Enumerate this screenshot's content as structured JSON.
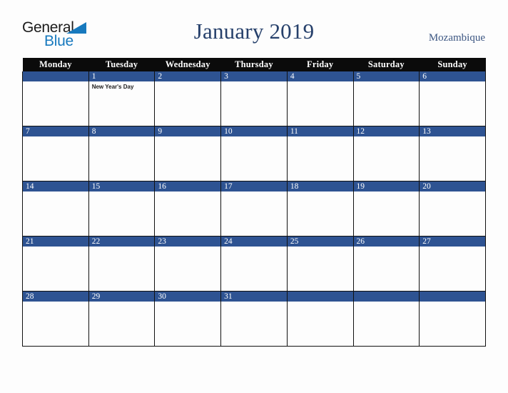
{
  "brand": {
    "line1": "General",
    "line2": "Blue",
    "triangle_color": "#1779be",
    "text_color": "#1b1b1b"
  },
  "header": {
    "title": "January 2019",
    "country": "Mozambique",
    "title_color": "#26406b"
  },
  "calendar": {
    "weekday_headers": [
      "Monday",
      "Tuesday",
      "Wednesday",
      "Thursday",
      "Friday",
      "Saturday",
      "Sunday"
    ],
    "header_bg": "#0b0b0b",
    "daybar_bg": "#2e5392",
    "grid_color": "#111111",
    "weeks": [
      [
        {
          "day": "",
          "events": []
        },
        {
          "day": "1",
          "events": [
            "New Year's Day"
          ]
        },
        {
          "day": "2",
          "events": []
        },
        {
          "day": "3",
          "events": []
        },
        {
          "day": "4",
          "events": []
        },
        {
          "day": "5",
          "events": []
        },
        {
          "day": "6",
          "events": []
        }
      ],
      [
        {
          "day": "7",
          "events": []
        },
        {
          "day": "8",
          "events": []
        },
        {
          "day": "9",
          "events": []
        },
        {
          "day": "10",
          "events": []
        },
        {
          "day": "11",
          "events": []
        },
        {
          "day": "12",
          "events": []
        },
        {
          "day": "13",
          "events": []
        }
      ],
      [
        {
          "day": "14",
          "events": []
        },
        {
          "day": "15",
          "events": []
        },
        {
          "day": "16",
          "events": []
        },
        {
          "day": "17",
          "events": []
        },
        {
          "day": "18",
          "events": []
        },
        {
          "day": "19",
          "events": []
        },
        {
          "day": "20",
          "events": []
        }
      ],
      [
        {
          "day": "21",
          "events": []
        },
        {
          "day": "22",
          "events": []
        },
        {
          "day": "23",
          "events": []
        },
        {
          "day": "24",
          "events": []
        },
        {
          "day": "25",
          "events": []
        },
        {
          "day": "26",
          "events": []
        },
        {
          "day": "27",
          "events": []
        }
      ],
      [
        {
          "day": "28",
          "events": []
        },
        {
          "day": "29",
          "events": []
        },
        {
          "day": "30",
          "events": []
        },
        {
          "day": "31",
          "events": []
        },
        {
          "day": "",
          "events": []
        },
        {
          "day": "",
          "events": []
        },
        {
          "day": "",
          "events": []
        }
      ]
    ]
  }
}
